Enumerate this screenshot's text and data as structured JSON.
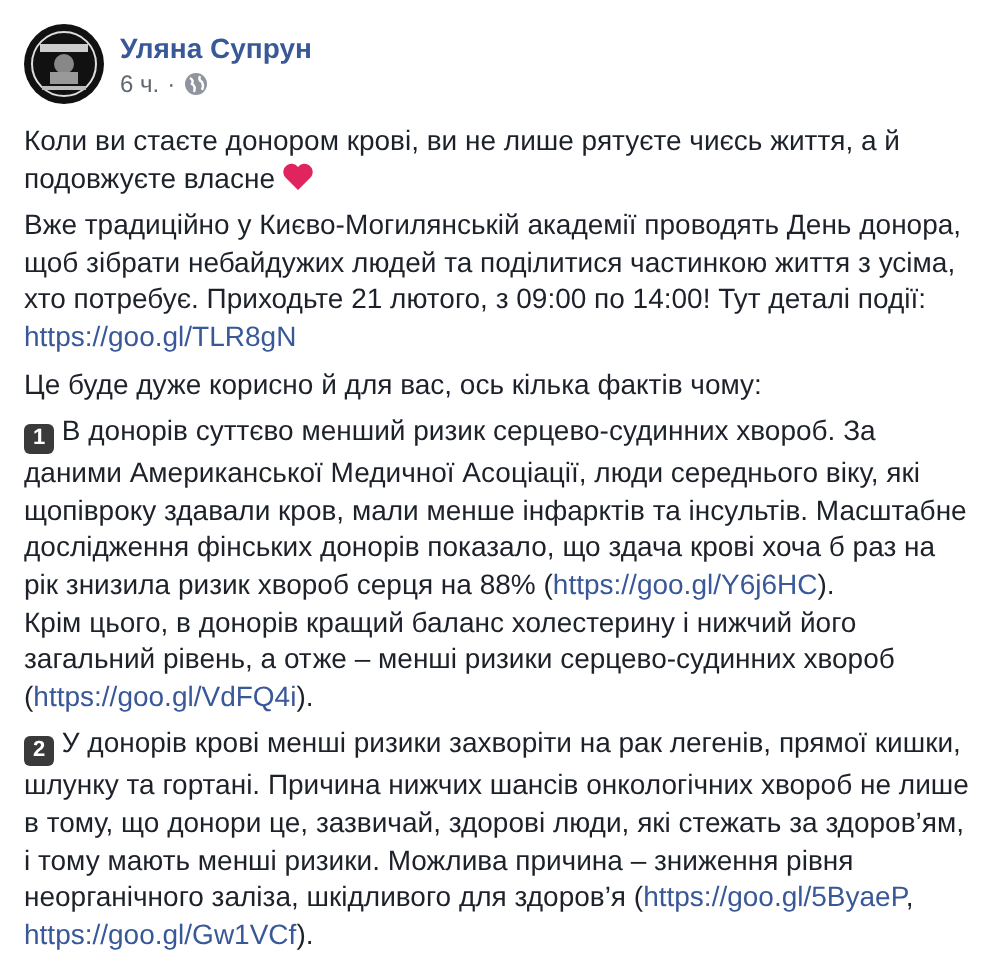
{
  "post": {
    "author": "Уляна Супрун",
    "time": "6 ч.",
    "separator": "·",
    "paragraphs": [
      {
        "lines": [
          [
            {
              "kind": "text",
              "text": "Коли ви стаєте донором крові, ви не лише рятуєте чиєсь життя, а й"
            }
          ],
          [
            {
              "kind": "text",
              "text": "подовжуєте власне "
            },
            {
              "kind": "heart"
            }
          ]
        ]
      },
      {
        "lines": [
          [
            {
              "kind": "text",
              "text": "Вже традиційно у Києво-Могилянській академії проводять День донора,"
            }
          ],
          [
            {
              "kind": "text",
              "text": "щоб зібрати небайдужих людей та поділитися частинкою життя з усіма,"
            }
          ],
          [
            {
              "kind": "text",
              "text": "хто потребує. Приходьте 21 лютого, з 09:00 по 14:00! Тут деталі події:"
            }
          ],
          [
            {
              "kind": "link",
              "text": "https://goo.gl/TLR8gN"
            }
          ]
        ]
      },
      {
        "lines": [
          [
            {
              "kind": "text",
              "text": "Це буде дуже корисно й для вас, ось кілька фактів чому:"
            }
          ]
        ]
      },
      {
        "lines": [
          [
            {
              "kind": "badge",
              "text": "1"
            },
            {
              "kind": "text",
              "text": " В донорів суттєво менший ризик серцево-судинних хвороб. За"
            }
          ],
          [
            {
              "kind": "text",
              "text": "даними Американської Медичної Асоціації, люди середнього віку, які"
            }
          ],
          [
            {
              "kind": "text",
              "text": "щопівроку здавали кров, мали менше інфарктів та інсультів. Масштабне"
            }
          ],
          [
            {
              "kind": "text",
              "text": "дослідження фінських донорів показало, що здача крові хоча б раз на"
            }
          ],
          [
            {
              "kind": "text",
              "text": "рік знизила ризик хвороб серця на 88% ("
            },
            {
              "kind": "link",
              "text": "https://goo.gl/Y6j6HC"
            },
            {
              "kind": "text",
              "text": ")."
            }
          ],
          [
            {
              "kind": "text",
              "text": "Крім цього, в донорів кращий баланс холестерину і нижчий його"
            }
          ],
          [
            {
              "kind": "text",
              "text": "загальний рівень, а отже – менші ризики серцево-судинних хвороб"
            }
          ],
          [
            {
              "kind": "text",
              "text": "("
            },
            {
              "kind": "link",
              "text": "https://goo.gl/VdFQ4i"
            },
            {
              "kind": "text",
              "text": ")."
            }
          ]
        ]
      },
      {
        "lines": [
          [
            {
              "kind": "badge",
              "text": "2"
            },
            {
              "kind": "text",
              "text": " У донорів крові менші ризики захворіти на рак легенів, прямої кишки,"
            }
          ],
          [
            {
              "kind": "text",
              "text": "шлунку та гортані. Причина нижчих шансів онкологічних хвороб не лише"
            }
          ],
          [
            {
              "kind": "text",
              "text": "в тому, що донори це, зазвичай, здорові люди, які стежать за здоров’ям,"
            }
          ],
          [
            {
              "kind": "text",
              "text": "і тому мають менші ризики. Можлива причина – зниження рівня"
            }
          ],
          [
            {
              "kind": "text",
              "text": "неорганічного заліза, шкідливого для здоров’я ("
            },
            {
              "kind": "link",
              "text": "https://goo.gl/5ByaeP"
            },
            {
              "kind": "text",
              "text": ","
            }
          ],
          [
            {
              "kind": "link",
              "text": "https://goo.gl/Gw1VCf"
            },
            {
              "kind": "text",
              "text": ")."
            }
          ]
        ]
      }
    ]
  }
}
